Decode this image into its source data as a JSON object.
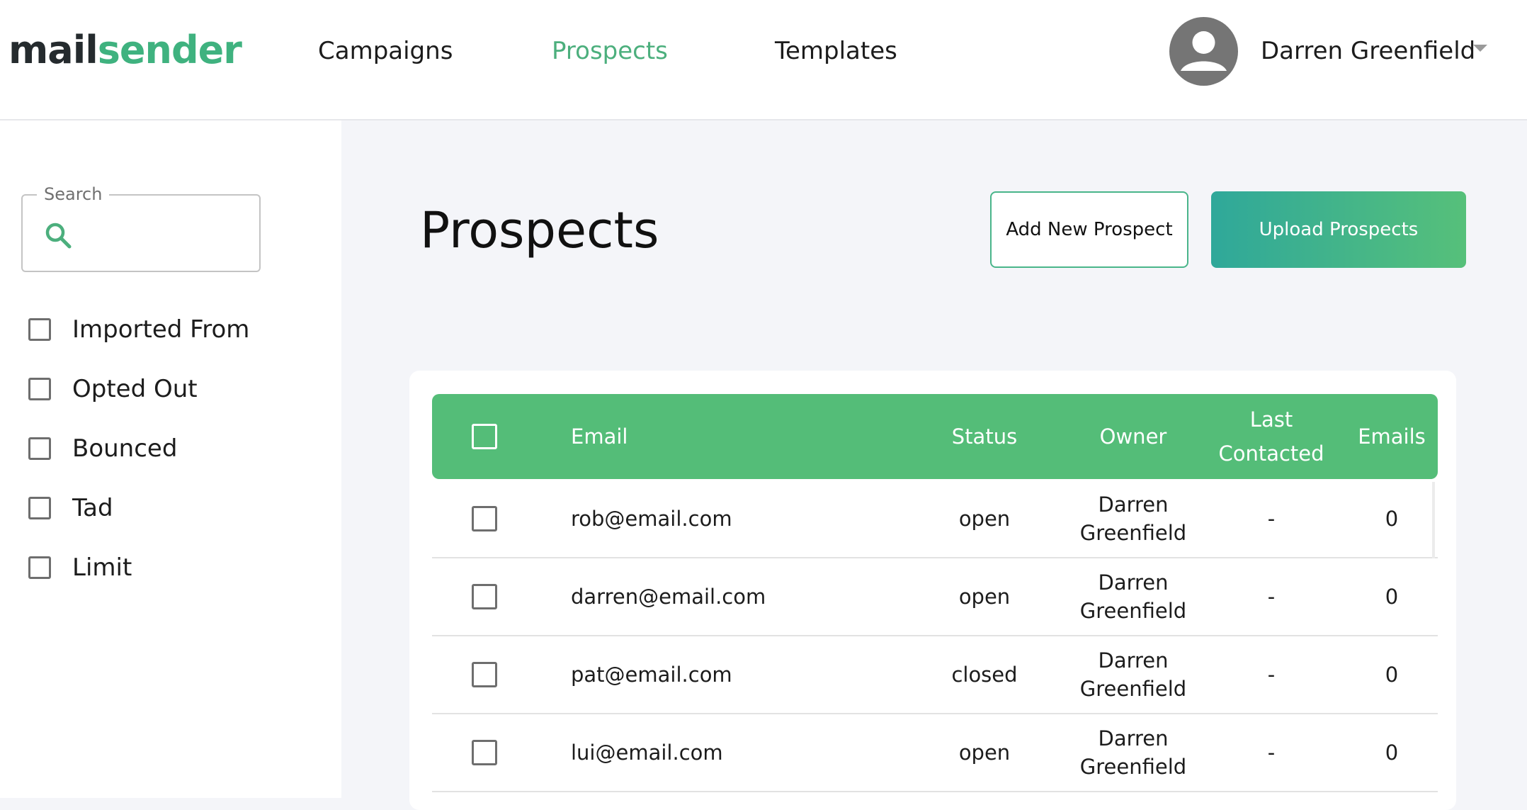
{
  "app": {
    "logo_part1": "mail",
    "logo_part2": "sender"
  },
  "nav": {
    "items": [
      {
        "label": "Campaigns",
        "active": false
      },
      {
        "label": "Prospects",
        "active": true
      },
      {
        "label": "Templates",
        "active": false
      }
    ]
  },
  "user": {
    "name": "Darren Greenfield"
  },
  "sidebar": {
    "search": {
      "label": "Search",
      "value": "",
      "placeholder": ""
    },
    "filters": [
      {
        "label": "Imported From",
        "checked": false
      },
      {
        "label": "Opted Out",
        "checked": false
      },
      {
        "label": "Bounced",
        "checked": false
      },
      {
        "label": "Tad",
        "checked": false
      },
      {
        "label": "Limit",
        "checked": false
      }
    ]
  },
  "main": {
    "title": "Prospects",
    "add_button": "Add New Prospect",
    "upload_button": "Upload Prospects"
  },
  "table": {
    "columns": {
      "email": "Email",
      "status": "Status",
      "owner": "Owner",
      "last_contacted_line1": "Last",
      "last_contacted_line2": "Contacted",
      "emails": "Emails"
    },
    "rows": [
      {
        "email": "rob@email.com",
        "status": "open",
        "owner_first": "Darren",
        "owner_last": "Greenfield",
        "last_contacted": "-",
        "emails": "0"
      },
      {
        "email": "darren@email.com",
        "status": "open",
        "owner_first": "Darren",
        "owner_last": "Greenfield",
        "last_contacted": "-",
        "emails": "0"
      },
      {
        "email": "pat@email.com",
        "status": "closed",
        "owner_first": "Darren",
        "owner_last": "Greenfield",
        "last_contacted": "-",
        "emails": "0"
      },
      {
        "email": "lui@email.com",
        "status": "open",
        "owner_first": "Darren",
        "owner_last": "Greenfield",
        "last_contacted": "-",
        "emails": "0"
      }
    ]
  },
  "colors": {
    "brand_green": "#4caf7d",
    "header_green": "#54bd78",
    "gradient_start": "#2fa89a",
    "gradient_end": "#56c07a"
  }
}
